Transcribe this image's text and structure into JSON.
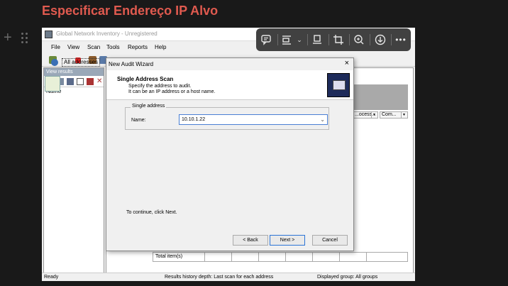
{
  "doc": {
    "heading": "Especificar Endereço IP Alvo",
    "heading_color": "#e05a4f"
  },
  "app": {
    "title": "Global Network Inventory - Unregistered",
    "menu": [
      "File",
      "View",
      "Scan",
      "Tools",
      "Reports",
      "Help"
    ],
    "left_panel": {
      "header": "View results",
      "column_name": "Name",
      "tree_item": "All addresses"
    },
    "columns": [
      "...ocess...",
      "Com..."
    ],
    "totals_label": "Total item(s)",
    "status": {
      "ready": "Ready",
      "history": "Results history depth: Last scan for each address",
      "group": "Displayed group: All groups"
    }
  },
  "dialog": {
    "title": "New Audit Wizard",
    "close": "×",
    "heading": "Single Address Scan",
    "desc1": "Specify the address to audit.",
    "desc2": "It can be an IP address or a host name.",
    "group_label": "Single address",
    "name_label": "Name:",
    "name_value": "10.10.1.22",
    "continue_text": "To continue, click Next.",
    "back": "< Back",
    "next": "Next >",
    "cancel": "Cancel"
  },
  "floating_toolbar": {
    "icons": [
      "comment-icon",
      "align-icon",
      "caption-icon",
      "crop-icon",
      "zoom-in-icon",
      "download-icon",
      "more-icon"
    ],
    "bg": "#414141"
  }
}
